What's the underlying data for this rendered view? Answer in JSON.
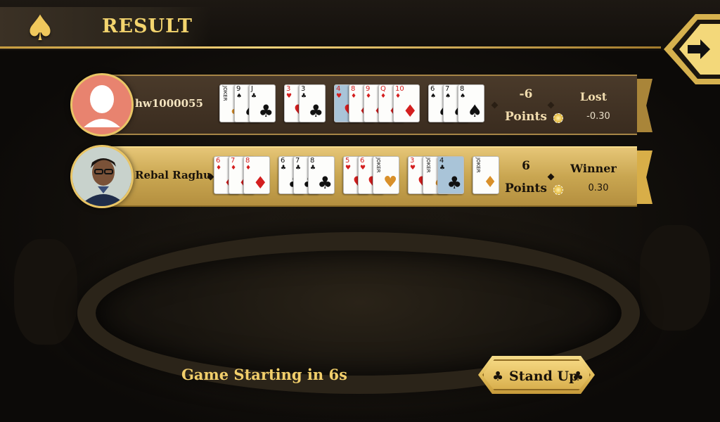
{
  "header": {
    "title": "RESULT",
    "logo_icon": "spade-icon",
    "next_icon": "arrow-right-icon"
  },
  "players": [
    {
      "name": "hw1000055",
      "avatar": "default-avatar",
      "points_value": "-6",
      "points_label": "Points",
      "status": "Lost",
      "amount": "-0.30",
      "groups": [
        [
          {
            "r": "JOKER",
            "s": "♣",
            "c": "joker"
          },
          {
            "r": "9",
            "s": "♠",
            "c": "black"
          },
          {
            "r": "J",
            "s": "♣",
            "c": "black"
          }
        ],
        [
          {
            "r": "3",
            "s": "♥",
            "c": "red"
          },
          {
            "r": "3",
            "s": "♣",
            "c": "black"
          }
        ],
        [
          {
            "r": "4",
            "s": "♥",
            "c": "wild"
          },
          {
            "r": "8",
            "s": "♦",
            "c": "red"
          },
          {
            "r": "9",
            "s": "♦",
            "c": "red"
          },
          {
            "r": "Q",
            "s": "♦",
            "c": "red"
          },
          {
            "r": "10",
            "s": "♦",
            "c": "red"
          }
        ],
        [
          {
            "r": "6",
            "s": "♠",
            "c": "black"
          },
          {
            "r": "7",
            "s": "♠",
            "c": "black"
          },
          {
            "r": "8",
            "s": "♠",
            "c": "black"
          }
        ]
      ]
    },
    {
      "name": "Rebal Raghu",
      "avatar": "photo-avatar",
      "points_value": "6",
      "points_label": "Points",
      "status": "Winner",
      "amount": "0.30",
      "groups": [
        [
          {
            "r": "6",
            "s": "♦",
            "c": "red"
          },
          {
            "r": "7",
            "s": "♦",
            "c": "red"
          },
          {
            "r": "8",
            "s": "♦",
            "c": "red"
          }
        ],
        [
          {
            "r": "6",
            "s": "♣",
            "c": "black"
          },
          {
            "r": "7",
            "s": "♣",
            "c": "black"
          },
          {
            "r": "8",
            "s": "♣",
            "c": "black"
          }
        ],
        [
          {
            "r": "5",
            "s": "♥",
            "c": "red"
          },
          {
            "r": "6",
            "s": "♥",
            "c": "red"
          },
          {
            "r": "JOKER",
            "s": "♥",
            "c": "joker"
          }
        ],
        [
          {
            "r": "3",
            "s": "♥",
            "c": "red"
          },
          {
            "r": "JOKER",
            "s": "♠",
            "c": "joker"
          },
          {
            "r": "4",
            "s": "♣",
            "c": "wild"
          }
        ],
        [
          {
            "r": "JOKER",
            "s": "♦",
            "c": "joker"
          }
        ]
      ]
    }
  ],
  "footer": {
    "countdown": "Game Starting in 6s",
    "stand_up": "Stand Up"
  }
}
